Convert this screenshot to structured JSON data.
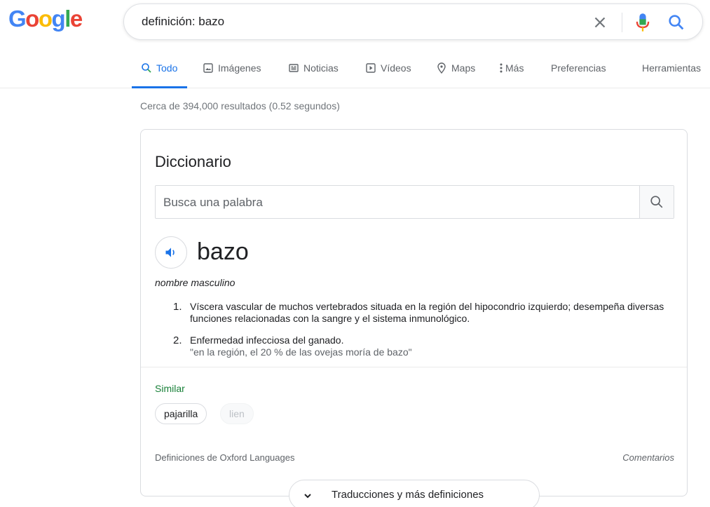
{
  "logo": {
    "letters": [
      "G",
      "o",
      "o",
      "g",
      "l",
      "e"
    ],
    "colors": [
      "#4285f4",
      "#ea4335",
      "#fbbc05",
      "#4285f4",
      "#34a853",
      "#ea4335"
    ]
  },
  "search": {
    "query": "definición: bazo",
    "icons": [
      "close-icon",
      "microphone-icon",
      "search-icon"
    ]
  },
  "tabs": [
    {
      "label": "Todo",
      "icon": "search-icon",
      "active": true
    },
    {
      "label": "Imágenes",
      "icon": "image-icon"
    },
    {
      "label": "Noticias",
      "icon": "news-icon"
    },
    {
      "label": "Vídeos",
      "icon": "play-icon"
    },
    {
      "label": "Maps",
      "icon": "map-pin-icon"
    },
    {
      "label": "Más",
      "icon": "more-vert-icon"
    },
    {
      "label": "Preferencias"
    },
    {
      "label": "Herramientas"
    }
  ],
  "stats": "Cerca de 394,000 resultados (0.52 segundos)",
  "dictionary": {
    "title": "Diccionario",
    "search_placeholder": "Busca una palabra",
    "word": "bazo",
    "part_of_speech": "nombre masculino",
    "definitions": [
      {
        "num": "1.",
        "text": "Víscera vascular de muchos vertebrados situada en la región del hipocondrio izquierdo; desempeña diversas funciones relacionadas con la sangre y el sistema inmunológico.",
        "example": ""
      },
      {
        "num": "2.",
        "text": "Enfermedad infecciosa del ganado.",
        "example": "\"en la región, el 20 % de las ovejas moría de bazo\""
      }
    ],
    "similar_label": "Similar",
    "similar": [
      "pajarilla",
      "lien"
    ],
    "source": "Definiciones de Oxford Languages",
    "feedback": "Comentarios",
    "expand_label": "Traducciones y más definiciones"
  },
  "colors": {
    "accent": "#1a73e8",
    "similar_green": "#188038"
  }
}
